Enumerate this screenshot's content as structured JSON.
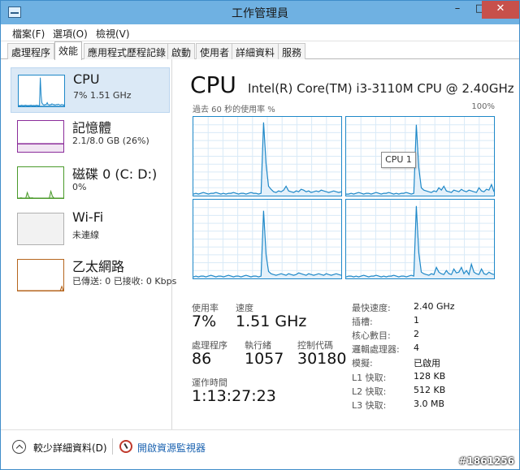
{
  "window": {
    "title": "工作管理員",
    "controls": {
      "minimize": "–",
      "maximize": "□",
      "close": "✕"
    }
  },
  "menu": {
    "file": "檔案(F)",
    "options": "選項(O)",
    "view": "檢視(V)"
  },
  "tabs": [
    "處理程序",
    "效能",
    "應用程式歷程記錄",
    "啟動",
    "使用者",
    "詳細資料",
    "服務"
  ],
  "active_tab": "效能",
  "sidebar": {
    "items": [
      {
        "title": "CPU",
        "sub": "7% 1.51 GHz",
        "color": "#1e88c8"
      },
      {
        "title": "記憶體",
        "sub": "2.1/8.0 GB (26%)",
        "color": "#8b2c9a"
      },
      {
        "title": "磁碟 0 (C: D:)",
        "sub": "0%",
        "color": "#4a9a2a"
      },
      {
        "title": "Wi-Fi",
        "sub": "未連線",
        "color": "#b0b0b0"
      },
      {
        "title": "乙太網路",
        "sub": "已傳送: 0 已接收: 0 Kbps",
        "color": "#b5651d"
      }
    ]
  },
  "main": {
    "title": "CPU",
    "model": "Intel(R) Core(TM) i3-3110M CPU @ 2.40GHz",
    "graph_caption": "過去 60 秒的使用率 %",
    "graph_max": "100%",
    "tooltip": "CPU 1",
    "cores": [
      [
        2,
        3,
        2,
        3,
        4,
        3,
        2,
        3,
        3,
        4,
        3,
        2,
        3,
        2,
        3,
        3,
        4,
        3,
        2,
        3,
        3,
        2,
        3,
        4,
        3,
        3,
        2,
        3,
        93,
        40,
        12,
        8,
        5,
        4,
        6,
        5,
        7,
        12,
        6,
        5,
        4,
        6,
        5,
        8,
        7,
        5,
        6,
        4,
        5,
        6,
        5,
        7,
        6,
        5,
        4,
        5,
        6,
        5,
        4,
        5
      ],
      [
        2,
        2,
        3,
        2,
        3,
        4,
        3,
        2,
        3,
        3,
        2,
        3,
        4,
        3,
        2,
        3,
        3,
        4,
        3,
        2,
        3,
        2,
        3,
        3,
        4,
        3,
        2,
        3,
        90,
        35,
        10,
        7,
        6,
        5,
        4,
        6,
        5,
        10,
        7,
        12,
        6,
        5,
        4,
        7,
        6,
        5,
        8,
        6,
        5,
        7,
        6,
        5,
        4,
        10,
        6,
        5,
        8,
        7,
        14,
        5
      ],
      [
        2,
        3,
        2,
        3,
        3,
        2,
        3,
        4,
        3,
        2,
        3,
        3,
        2,
        3,
        4,
        3,
        2,
        3,
        3,
        2,
        3,
        4,
        3,
        2,
        3,
        3,
        2,
        3,
        86,
        30,
        9,
        6,
        5,
        4,
        5,
        6,
        5,
        4,
        6,
        5,
        4,
        5,
        7,
        6,
        5,
        4,
        6,
        5,
        4,
        5,
        6,
        5,
        4,
        6,
        5,
        4,
        5,
        6,
        5,
        4
      ],
      [
        2,
        3,
        3,
        2,
        3,
        2,
        3,
        4,
        3,
        2,
        3,
        3,
        4,
        3,
        2,
        3,
        2,
        3,
        3,
        4,
        3,
        2,
        3,
        3,
        2,
        3,
        4,
        3,
        92,
        32,
        8,
        6,
        5,
        4,
        6,
        5,
        14,
        8,
        6,
        5,
        10,
        6,
        5,
        12,
        7,
        8,
        14,
        6,
        10,
        5,
        18,
        8,
        6,
        5,
        12,
        6,
        5,
        8,
        6,
        5
      ]
    ],
    "stats": {
      "utilization": {
        "label": "使用率",
        "value": "7%"
      },
      "speed": {
        "label": "速度",
        "value": "1.51 GHz"
      },
      "processes": {
        "label": "處理程序",
        "value": "86"
      },
      "threads": {
        "label": "執行緒",
        "value": "1057"
      },
      "handles": {
        "label": "控制代碼",
        "value": "30180"
      },
      "uptime": {
        "label": "運作時間",
        "value": "1:13:27:23"
      }
    },
    "specs": [
      {
        "label": "最快速度:",
        "value": "2.40 GHz"
      },
      {
        "label": "插槽:",
        "value": "1"
      },
      {
        "label": "核心數目:",
        "value": "2"
      },
      {
        "label": "邏輯處理器:",
        "value": "4"
      },
      {
        "label": "模擬:",
        "value": "已啟用"
      },
      {
        "label": "L1 快取:",
        "value": "128 KB"
      },
      {
        "label": "L2 快取:",
        "value": "512 KB"
      },
      {
        "label": "L3 快取:",
        "value": "3.0 MB"
      }
    ]
  },
  "footer": {
    "fewer_details": "較少詳細資料(D)",
    "resource_monitor": "開啟資源監視器"
  },
  "watermark": "#1861256"
}
